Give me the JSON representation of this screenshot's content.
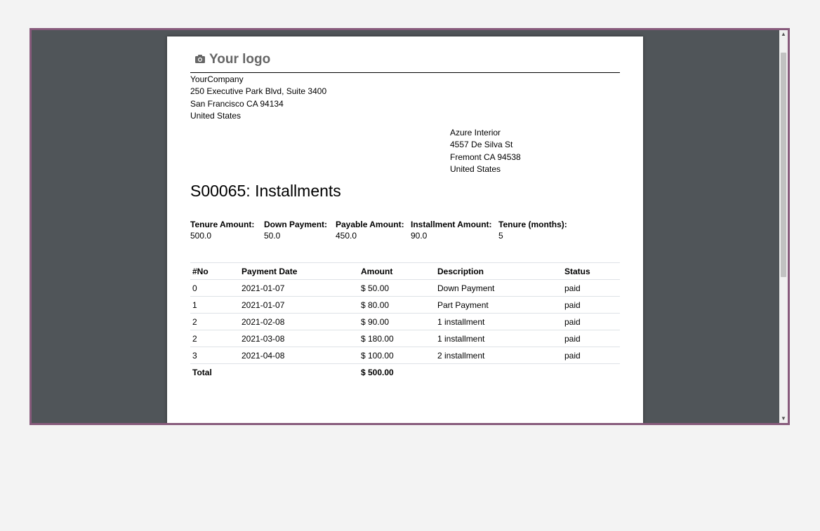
{
  "logo": {
    "text": "Your logo"
  },
  "company": {
    "name": "YourCompany",
    "street": "250 Executive Park Blvd, Suite 3400",
    "city": "San Francisco CA 94134",
    "country": "United States"
  },
  "partner": {
    "name": "Azure Interior",
    "street": "4557 De Silva St",
    "city": "Fremont CA 94538",
    "country": "United States"
  },
  "title": "S00065: Installments",
  "summary": [
    {
      "label": "Tenure Amount:",
      "value": "500.0"
    },
    {
      "label": "Down Payment:",
      "value": "50.0"
    },
    {
      "label": "Payable Amount:",
      "value": "450.0"
    },
    {
      "label": "Installment Amount:",
      "value": "90.0"
    },
    {
      "label": "Tenure (months):",
      "value": "5"
    }
  ],
  "table": {
    "headers": [
      "#No",
      "Payment Date",
      "Amount",
      "Description",
      "Status"
    ],
    "rows": [
      [
        "0",
        "2021-01-07",
        "$ 50.00",
        "Down Payment",
        "paid"
      ],
      [
        "1",
        "2021-01-07",
        "$ 80.00",
        "Part Payment",
        "paid"
      ],
      [
        "2",
        "2021-02-08",
        "$ 90.00",
        "1 installment",
        "paid"
      ],
      [
        "2",
        "2021-03-08",
        "$ 180.00",
        "1 installment",
        "paid"
      ],
      [
        "3",
        "2021-04-08",
        "$ 100.00",
        "2 installment",
        "paid"
      ]
    ],
    "total_label": "Total",
    "total_amount": "$ 500.00"
  },
  "colors": {
    "frame_border": "#875a7b",
    "viewer_background": "#505559",
    "page_background": "#f3f3f3"
  },
  "icons": {
    "logo": "camera-icon",
    "scroll_up": "arrow-up-icon",
    "scroll_down": "arrow-down-icon"
  }
}
